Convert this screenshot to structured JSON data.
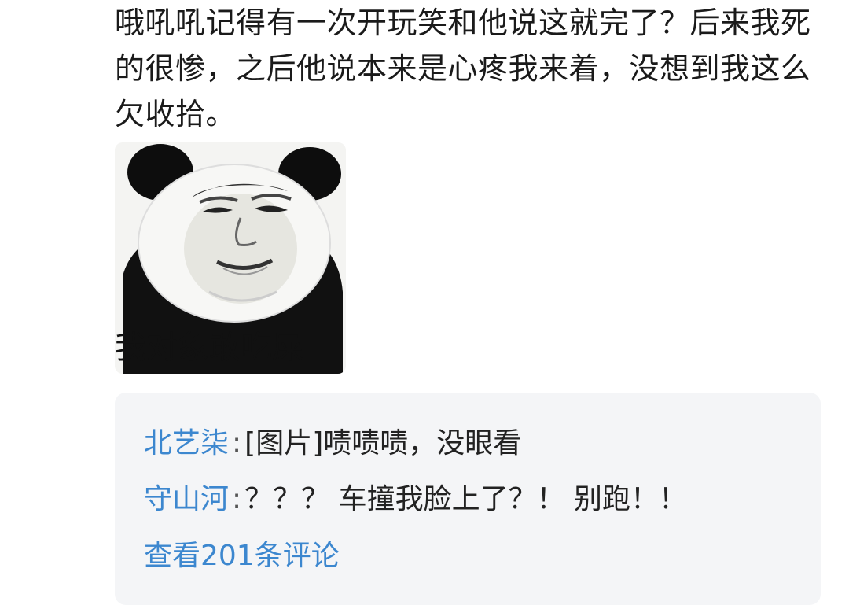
{
  "post": {
    "text": "哦吼吼记得有一次开玩笑和他说这就完了？后来我死的很惨，之后他说本来是心疼我来着，没想到我这么欠收拾。"
  },
  "meme": {
    "caption": "我对象敢吃屎"
  },
  "comments": {
    "items": [
      {
        "author": "北艺柒",
        "separator": ":",
        "text": "[图片]啧啧啧，没眼看"
      },
      {
        "author": "守山河",
        "separator": ":",
        "text": "？？？ 车撞我脸上了？！ 别跑！！"
      }
    ],
    "view_all_label": "查看201条评论"
  },
  "colors": {
    "link": "#3c87cf",
    "text": "#1a1a1a",
    "comment_bg": "#f4f5f7"
  }
}
